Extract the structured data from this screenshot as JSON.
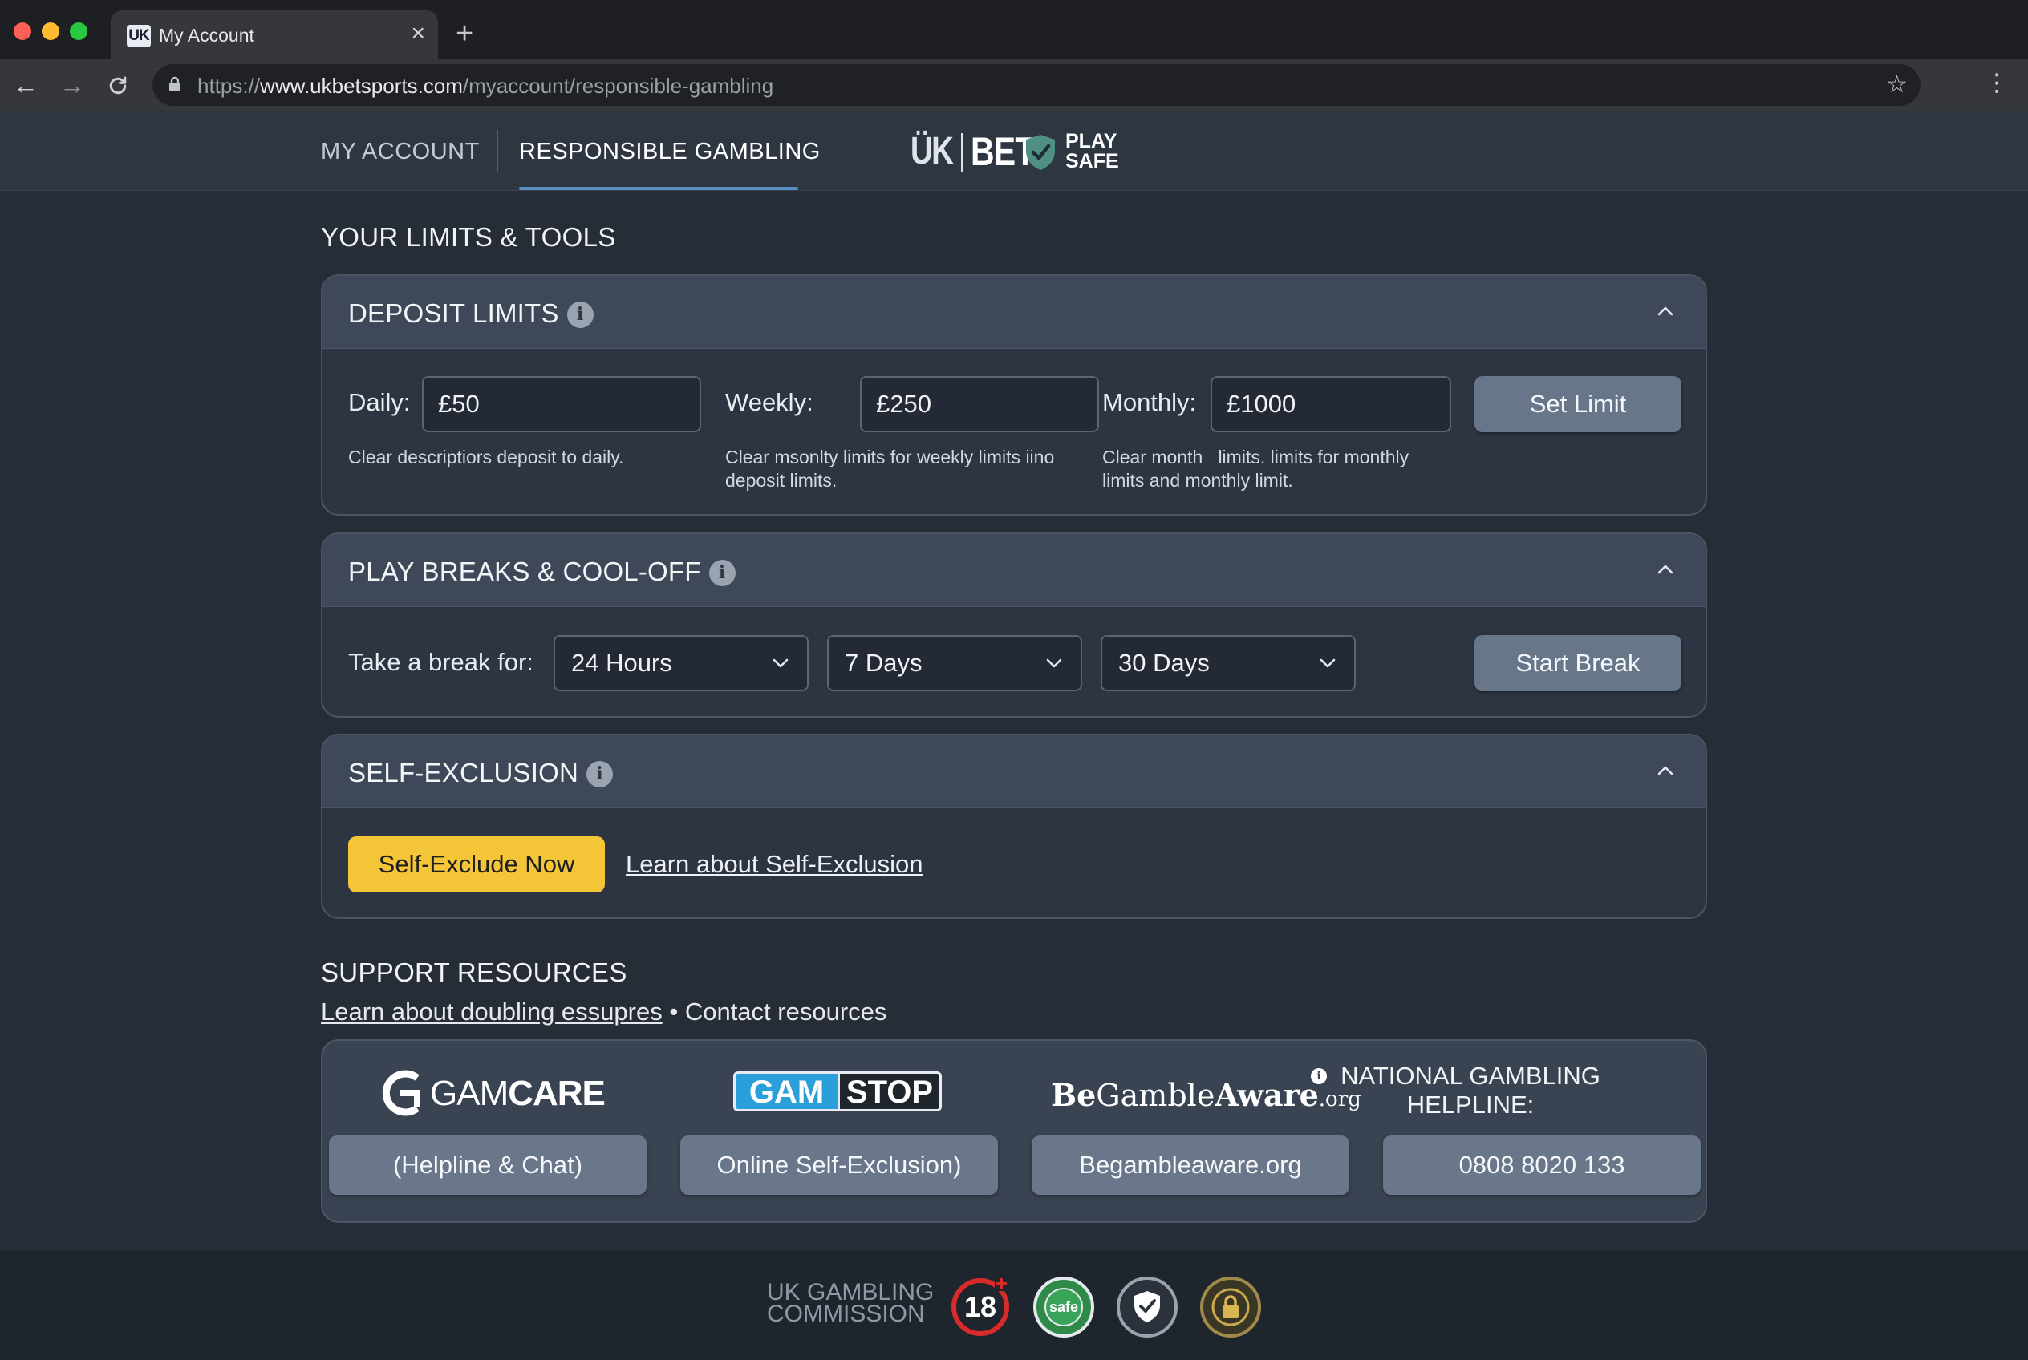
{
  "browser": {
    "tab_favicon": "UK",
    "tab_title": "My Account",
    "url_scheme": "https://",
    "url_host": "www.ukbetsports.com",
    "url_path": "/myaccount/responsible-gambling",
    "traffic_lights": [
      "#fe5f57",
      "#febc2e",
      "#28c840"
    ]
  },
  "header": {
    "nav": [
      "MY ACCOUNT",
      "RESPONSIBLE GAMBLING"
    ],
    "active_nav": "RESPONSIBLE GAMBLING",
    "logo": {
      "uk": "ÜK",
      "bet": "BET",
      "play": "PLAY",
      "safe": "SAFE"
    },
    "accent_color": "#5a8fc4"
  },
  "page_title": "YOUR LIMITS & TOOLS",
  "deposit_limits": {
    "title": "DEPOSIT LIMITS",
    "daily": {
      "label": "Daily:",
      "value": "£50",
      "desc": "Clear descriptiors deposit to daily."
    },
    "weekly": {
      "label": "Weekly:",
      "value": "£250",
      "desc": "Clear msonlty limits for weekly limits iino deposit limits."
    },
    "monthly": {
      "label": "Monthly:",
      "value": "£1000",
      "desc": "Clear month   limits. limits for monthly limits and monthly limit."
    },
    "button": "Set Limit"
  },
  "play_breaks": {
    "title": "PLAY BREAKS & COOL-OFF",
    "label": "Take a break for:",
    "options": [
      "24 Hours",
      "7 Days",
      "30 Days"
    ],
    "button": "Start Break"
  },
  "self_exclusion": {
    "title": "SELF-EXCLUSION",
    "button": "Self-Exclude Now",
    "link": "Learn about Self-Exclusion",
    "button_color": "#f4c537"
  },
  "support": {
    "title": "SUPPORT RESOURCES",
    "link": "Learn about doubling essupres",
    "bullet": "•",
    "text": "Contact resources",
    "resources": [
      {
        "logo": "GAMCARE",
        "logo_prefix": "GAM",
        "logo_suffix": "CARE",
        "button": "(Helpline & Chat)"
      },
      {
        "logo": "GAMSTOP",
        "logo_prefix": "GAM",
        "logo_suffix": "STOP",
        "button": "Online Self-Exclusion)"
      },
      {
        "logo": "BeGambleAware.org",
        "logo_be": "Be",
        "logo_gamble": "Gamble",
        "logo_aware": "Aware",
        "logo_org": ".org",
        "button": "Begambleaware.org"
      },
      {
        "logo": "NATIONAL GAMBLING HELPLINE:",
        "logo_line1": "NATIONAL GAMBLING",
        "logo_line2": "HELPLINE:",
        "button": "0808 8020 133"
      }
    ]
  },
  "footer": {
    "commission_line1": "UK GAMBLING",
    "commission_line2": "COMMISSION",
    "age_badge": "18",
    "safe_badge": "safe",
    "badges": [
      "18-plus-badge",
      "gambling-safe-badge",
      "safe-gambling-shield-badge",
      "padlock-secure-badge"
    ]
  }
}
